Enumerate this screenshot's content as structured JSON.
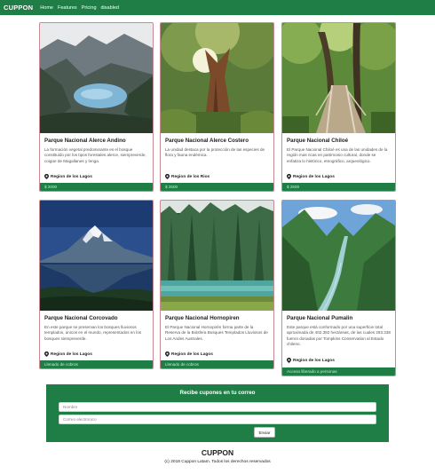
{
  "navbar": {
    "brand": "CUPPON",
    "links": [
      "Home",
      "Features",
      "Pricing",
      "disabled"
    ]
  },
  "colors": {
    "accent": "#1e7e46",
    "card_border": "#c98a94"
  },
  "cards": [
    {
      "title": "Parque Nacional Alerce Andino",
      "description": "La formación vegetal predominante es el bosque constituido por los tipos forestales alerce, siempreverde, coigüe de Magallanes y lenga.",
      "region": "Region de los Lagos",
      "footer": "$ 2000",
      "image": "lake-valley"
    },
    {
      "title": "Parque Nacional Alerce Costero",
      "description": "La unidad destaca por la protección de las especies de flora y fauna endémica.",
      "region": "Region de los Rios",
      "footer": "$ 2500",
      "image": "giant-alerce-tree"
    },
    {
      "title": "Parque Nacional Chiloé",
      "description": "El Parque Nacional Chiloé es una de las unidades de la región mas ricas en patrimonio cultural, donde se enfatiza lo histórico, etnográfico, arqueológico.",
      "region": "Region de los Lagos",
      "footer": "$ 2500",
      "image": "forest-boardwalk"
    },
    {
      "title": "Parque Nacional Corcovado",
      "description": "En este parque se preservan los bosques lluviosos templados, únicos en el mundo, representados en los bosques siempreverde.",
      "region": "Region de los Lagos",
      "footer": "Llenado de cobros",
      "image": "volcano-reflection"
    },
    {
      "title": "Parque Nacional Hornopiren",
      "description": "El Parque Nacional Hornopirén forma parte de la Reserva de la Biósfera Bosques Templados Lluviosos de Los Andes Australes.",
      "region": "Region de los Lagos",
      "footer": "Llenado de cobros",
      "image": "forest-lake"
    },
    {
      "title": "Parque Nacional Pumalin",
      "description": "Este parque está conformado por una superficie total aproximada de 402.392 hectáreas, de las cuales 293.338 fueron donadas por Tompkins Conservation al Estado chileno.",
      "region": "Region de los Lagos",
      "footer": "Acceso liberado a personas",
      "image": "river-valley"
    }
  ],
  "newsletter": {
    "title": "Recibe cupones en tu correo",
    "name_placeholder": "Nombre",
    "email_placeholder": "Correo electronico",
    "button": "Enviar"
  },
  "footer": {
    "brand": "CUPPON",
    "copyright": "(c) 2018 Cuppon Latam. Todos los derechos reservados"
  }
}
